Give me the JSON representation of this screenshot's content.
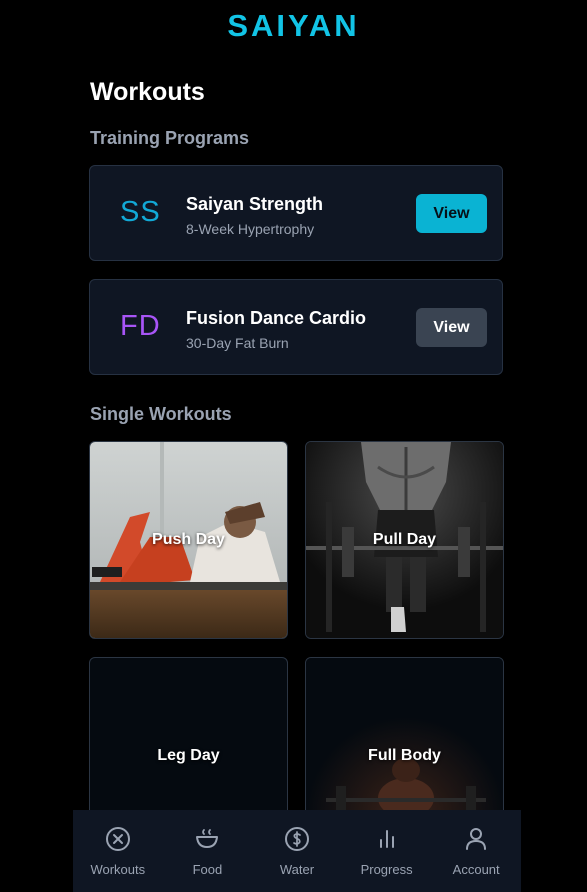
{
  "brand": "SAIYAN",
  "page_title": "Workouts",
  "sections": {
    "programs_title": "Training Programs",
    "singles_title": "Single Workouts"
  },
  "programs": [
    {
      "initials": "SS",
      "name": "Saiyan Strength",
      "subtitle": "8-Week Hypertrophy",
      "button": "View",
      "initials_color": "#12a9d6"
    },
    {
      "initials": "FD",
      "name": "Fusion Dance Cardio",
      "subtitle": "30-Day Fat Burn",
      "button": "View",
      "initials_color": "#a855f7"
    }
  ],
  "workouts": [
    {
      "label": "Push Day"
    },
    {
      "label": "Pull Day"
    },
    {
      "label": "Leg Day"
    },
    {
      "label": "Full Body"
    }
  ],
  "nav": [
    {
      "label": "Workouts",
      "icon": "workouts-icon"
    },
    {
      "label": "Food",
      "icon": "food-icon"
    },
    {
      "label": "Water",
      "icon": "water-icon"
    },
    {
      "label": "Progress",
      "icon": "progress-icon"
    },
    {
      "label": "Account",
      "icon": "account-icon"
    }
  ],
  "colors": {
    "accent": "#12c4e6",
    "background": "#000000",
    "card": "#0f1623"
  }
}
